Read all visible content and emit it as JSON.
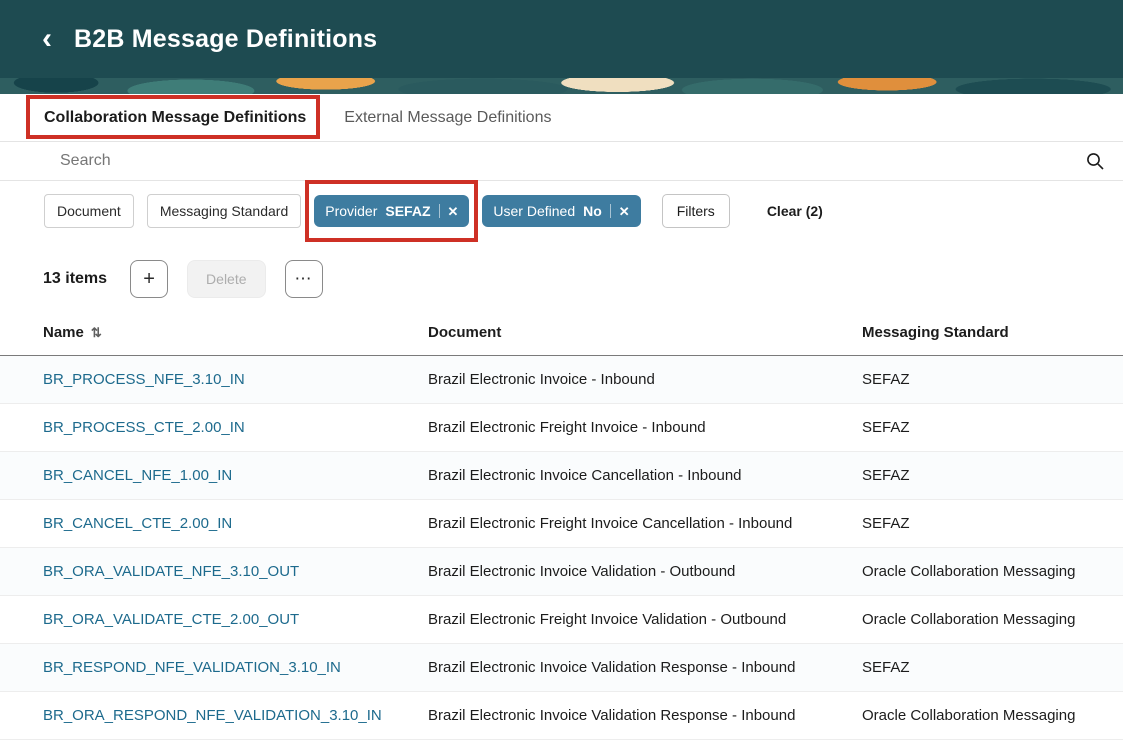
{
  "colors": {
    "header_bg": "#1e4b51",
    "selected_chip_bg": "#3e7ca0",
    "link": "#1d6a8d",
    "annotation_highlight": "#ce3025"
  },
  "header": {
    "back_icon": "‹",
    "title": "B2B Message Definitions"
  },
  "tabs": [
    {
      "label": "Collaboration Message Definitions"
    },
    {
      "label": "External Message Definitions"
    }
  ],
  "search": {
    "placeholder": "Search",
    "icon": "magnifier"
  },
  "filter_bar": {
    "document_chip": "Document",
    "messaging_standard_chip": "Messaging Standard",
    "provider_chip": {
      "label": "Provider",
      "value": "SEFAZ",
      "close_icon": "✕"
    },
    "user_defined_chip": {
      "label": "User Defined",
      "value": "No",
      "close_icon": "✕"
    },
    "filters_button": "Filters",
    "clear_button": "Clear (2)"
  },
  "toolbar": {
    "items_count": "13 items",
    "add_icon": "+",
    "delete_button": "Delete",
    "more_icon": "⋯"
  },
  "table": {
    "columns": {
      "name": "Name",
      "document": "Document",
      "standard": "Messaging Standard"
    },
    "sort_icon": "⇅",
    "rows": [
      {
        "name": "BR_PROCESS_NFE_3.10_IN",
        "document": "Brazil Electronic Invoice - Inbound",
        "standard": "SEFAZ"
      },
      {
        "name": "BR_PROCESS_CTE_2.00_IN",
        "document": "Brazil Electronic Freight Invoice - Inbound",
        "standard": "SEFAZ"
      },
      {
        "name": "BR_CANCEL_NFE_1.00_IN",
        "document": "Brazil Electronic Invoice Cancellation - Inbound",
        "standard": "SEFAZ"
      },
      {
        "name": "BR_CANCEL_CTE_2.00_IN",
        "document": "Brazil Electronic Freight Invoice Cancellation - Inbound",
        "standard": "SEFAZ"
      },
      {
        "name": "BR_ORA_VALIDATE_NFE_3.10_OUT",
        "document": "Brazil Electronic Invoice Validation - Outbound",
        "standard": "Oracle Collaboration Messaging"
      },
      {
        "name": "BR_ORA_VALIDATE_CTE_2.00_OUT",
        "document": "Brazil Electronic Freight Invoice Validation - Outbound",
        "standard": "Oracle Collaboration Messaging"
      },
      {
        "name": "BR_RESPOND_NFE_VALIDATION_3.10_IN",
        "document": "Brazil Electronic Invoice Validation Response - Inbound",
        "standard": "SEFAZ"
      },
      {
        "name": "BR_ORA_RESPOND_NFE_VALIDATION_3.10_IN",
        "document": "Brazil Electronic Invoice Validation Response - Inbound",
        "standard": "Oracle Collaboration Messaging"
      }
    ]
  }
}
